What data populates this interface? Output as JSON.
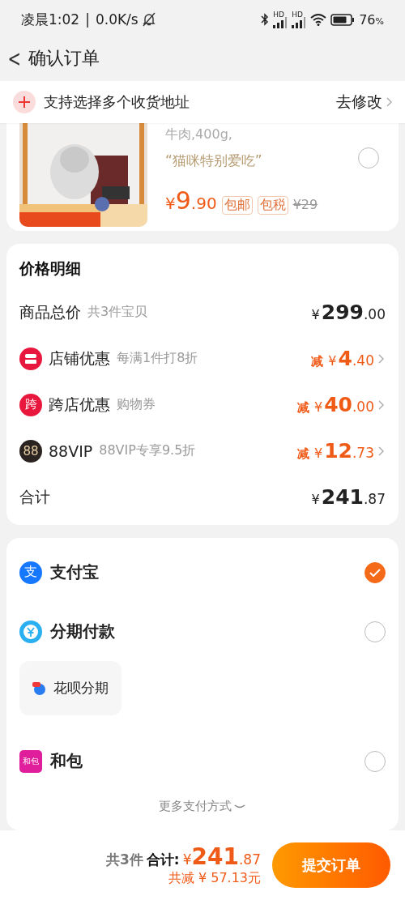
{
  "status_bar": {
    "time": "凌晨1:02",
    "separator": "|",
    "speed": "0.0K/s",
    "signal_labels": [
      "HD",
      "HD"
    ],
    "battery": "76",
    "battery_unit": "%"
  },
  "header": {
    "back": "<",
    "title": "确认订单"
  },
  "address_banner": {
    "text": "支持选择多个收货地址",
    "action": "去修改"
  },
  "product": {
    "title_tail": "牛肉,400g,",
    "comment": "“猫咪特别爱吃”",
    "selected": false,
    "price": {
      "symbol": "¥",
      "main": "9",
      "cents": ".90"
    },
    "tags": [
      "包邮",
      "包税"
    ],
    "original_price": "¥29"
  },
  "price_detail": {
    "title": "价格明细",
    "rows": [
      {
        "kind": "total",
        "label": "商品总价",
        "note": "共3件宝贝",
        "symbol": "¥",
        "main": "299",
        "cents": ".00"
      },
      {
        "kind": "store",
        "label": "店铺优惠",
        "note": "每满1件打8折",
        "prefix": "减",
        "symbol": "¥",
        "main": "4",
        "cents": ".40"
      },
      {
        "kind": "cross",
        "icon_text": "跨",
        "label": "跨店优惠",
        "note": "购物券",
        "prefix": "减",
        "symbol": "¥",
        "main": "40",
        "cents": ".00"
      },
      {
        "kind": "vip",
        "icon_text": "88",
        "label": "88VIP",
        "note": "88VIP专享9.5折",
        "prefix": "减",
        "symbol": "¥",
        "main": "12",
        "cents": ".73"
      },
      {
        "kind": "sum",
        "label": "合计",
        "symbol": "¥",
        "main": "241",
        "cents": ".87"
      }
    ]
  },
  "payment": {
    "methods": [
      {
        "kind": "alipay",
        "icon_text": "支",
        "name": "支付宝",
        "selected": true
      },
      {
        "kind": "installment",
        "name": "分期付款",
        "selected": false,
        "sub": "花呗分期"
      },
      {
        "kind": "hebao",
        "icon_text": "和包",
        "name": "和包",
        "selected": false
      }
    ],
    "more": "更多支付方式"
  },
  "bottom_bar": {
    "count": "共3件",
    "total_label": "合计:",
    "symbol": "¥",
    "main": "241",
    "cents": ".87",
    "saved": "共减 ¥ 57.13元",
    "submit": "提交订单"
  }
}
